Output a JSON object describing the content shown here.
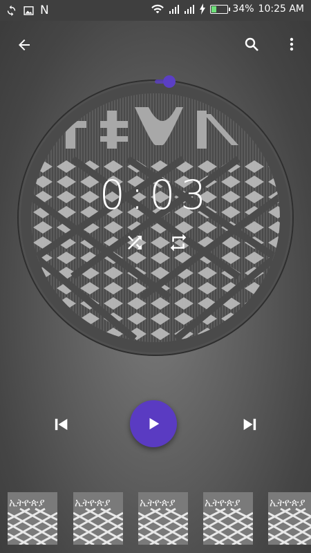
{
  "status_bar": {
    "left_icons": [
      "sync-icon",
      "image-icon",
      "n-notification-icon"
    ],
    "n_label": "N",
    "battery_percent": "34%",
    "battery_level": 0.34,
    "time": "10:25 AM"
  },
  "toolbar": {
    "back_icon": "arrow-back-icon",
    "search_icon": "search-icon",
    "menu_icon": "more-vert-icon"
  },
  "player": {
    "elapsed_time": "0:03",
    "progress": 0.01,
    "accent_color": "#5a3bc2",
    "shuffle_icon": "shuffle-icon",
    "repeat_icon": "repeat-icon",
    "previous_icon": "skip-previous-icon",
    "play_icon": "play-icon",
    "next_icon": "skip-next-icon"
  },
  "queue": {
    "album_art_text": "ኢትዮጵያ",
    "item_count_visible": 5
  }
}
